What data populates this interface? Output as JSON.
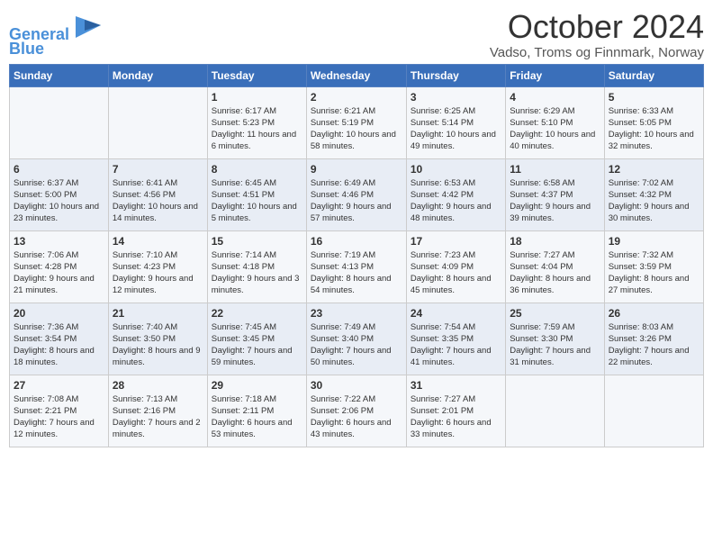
{
  "header": {
    "logo_line1": "General",
    "logo_line2": "Blue",
    "month_title": "October 2024",
    "subtitle": "Vadso, Troms og Finnmark, Norway"
  },
  "days_of_week": [
    "Sunday",
    "Monday",
    "Tuesday",
    "Wednesday",
    "Thursday",
    "Friday",
    "Saturday"
  ],
  "weeks": [
    [
      {
        "day": "",
        "info": ""
      },
      {
        "day": "",
        "info": ""
      },
      {
        "day": "1",
        "info": "Sunrise: 6:17 AM\nSunset: 5:23 PM\nDaylight: 11 hours and 6 minutes."
      },
      {
        "day": "2",
        "info": "Sunrise: 6:21 AM\nSunset: 5:19 PM\nDaylight: 10 hours and 58 minutes."
      },
      {
        "day": "3",
        "info": "Sunrise: 6:25 AM\nSunset: 5:14 PM\nDaylight: 10 hours and 49 minutes."
      },
      {
        "day": "4",
        "info": "Sunrise: 6:29 AM\nSunset: 5:10 PM\nDaylight: 10 hours and 40 minutes."
      },
      {
        "day": "5",
        "info": "Sunrise: 6:33 AM\nSunset: 5:05 PM\nDaylight: 10 hours and 32 minutes."
      }
    ],
    [
      {
        "day": "6",
        "info": "Sunrise: 6:37 AM\nSunset: 5:00 PM\nDaylight: 10 hours and 23 minutes."
      },
      {
        "day": "7",
        "info": "Sunrise: 6:41 AM\nSunset: 4:56 PM\nDaylight: 10 hours and 14 minutes."
      },
      {
        "day": "8",
        "info": "Sunrise: 6:45 AM\nSunset: 4:51 PM\nDaylight: 10 hours and 5 minutes."
      },
      {
        "day": "9",
        "info": "Sunrise: 6:49 AM\nSunset: 4:46 PM\nDaylight: 9 hours and 57 minutes."
      },
      {
        "day": "10",
        "info": "Sunrise: 6:53 AM\nSunset: 4:42 PM\nDaylight: 9 hours and 48 minutes."
      },
      {
        "day": "11",
        "info": "Sunrise: 6:58 AM\nSunset: 4:37 PM\nDaylight: 9 hours and 39 minutes."
      },
      {
        "day": "12",
        "info": "Sunrise: 7:02 AM\nSunset: 4:32 PM\nDaylight: 9 hours and 30 minutes."
      }
    ],
    [
      {
        "day": "13",
        "info": "Sunrise: 7:06 AM\nSunset: 4:28 PM\nDaylight: 9 hours and 21 minutes."
      },
      {
        "day": "14",
        "info": "Sunrise: 7:10 AM\nSunset: 4:23 PM\nDaylight: 9 hours and 12 minutes."
      },
      {
        "day": "15",
        "info": "Sunrise: 7:14 AM\nSunset: 4:18 PM\nDaylight: 9 hours and 3 minutes."
      },
      {
        "day": "16",
        "info": "Sunrise: 7:19 AM\nSunset: 4:13 PM\nDaylight: 8 hours and 54 minutes."
      },
      {
        "day": "17",
        "info": "Sunrise: 7:23 AM\nSunset: 4:09 PM\nDaylight: 8 hours and 45 minutes."
      },
      {
        "day": "18",
        "info": "Sunrise: 7:27 AM\nSunset: 4:04 PM\nDaylight: 8 hours and 36 minutes."
      },
      {
        "day": "19",
        "info": "Sunrise: 7:32 AM\nSunset: 3:59 PM\nDaylight: 8 hours and 27 minutes."
      }
    ],
    [
      {
        "day": "20",
        "info": "Sunrise: 7:36 AM\nSunset: 3:54 PM\nDaylight: 8 hours and 18 minutes."
      },
      {
        "day": "21",
        "info": "Sunrise: 7:40 AM\nSunset: 3:50 PM\nDaylight: 8 hours and 9 minutes."
      },
      {
        "day": "22",
        "info": "Sunrise: 7:45 AM\nSunset: 3:45 PM\nDaylight: 7 hours and 59 minutes."
      },
      {
        "day": "23",
        "info": "Sunrise: 7:49 AM\nSunset: 3:40 PM\nDaylight: 7 hours and 50 minutes."
      },
      {
        "day": "24",
        "info": "Sunrise: 7:54 AM\nSunset: 3:35 PM\nDaylight: 7 hours and 41 minutes."
      },
      {
        "day": "25",
        "info": "Sunrise: 7:59 AM\nSunset: 3:30 PM\nDaylight: 7 hours and 31 minutes."
      },
      {
        "day": "26",
        "info": "Sunrise: 8:03 AM\nSunset: 3:26 PM\nDaylight: 7 hours and 22 minutes."
      }
    ],
    [
      {
        "day": "27",
        "info": "Sunrise: 7:08 AM\nSunset: 2:21 PM\nDaylight: 7 hours and 12 minutes."
      },
      {
        "day": "28",
        "info": "Sunrise: 7:13 AM\nSunset: 2:16 PM\nDaylight: 7 hours and 2 minutes."
      },
      {
        "day": "29",
        "info": "Sunrise: 7:18 AM\nSunset: 2:11 PM\nDaylight: 6 hours and 53 minutes."
      },
      {
        "day": "30",
        "info": "Sunrise: 7:22 AM\nSunset: 2:06 PM\nDaylight: 6 hours and 43 minutes."
      },
      {
        "day": "31",
        "info": "Sunrise: 7:27 AM\nSunset: 2:01 PM\nDaylight: 6 hours and 33 minutes."
      },
      {
        "day": "",
        "info": ""
      },
      {
        "day": "",
        "info": ""
      }
    ]
  ]
}
